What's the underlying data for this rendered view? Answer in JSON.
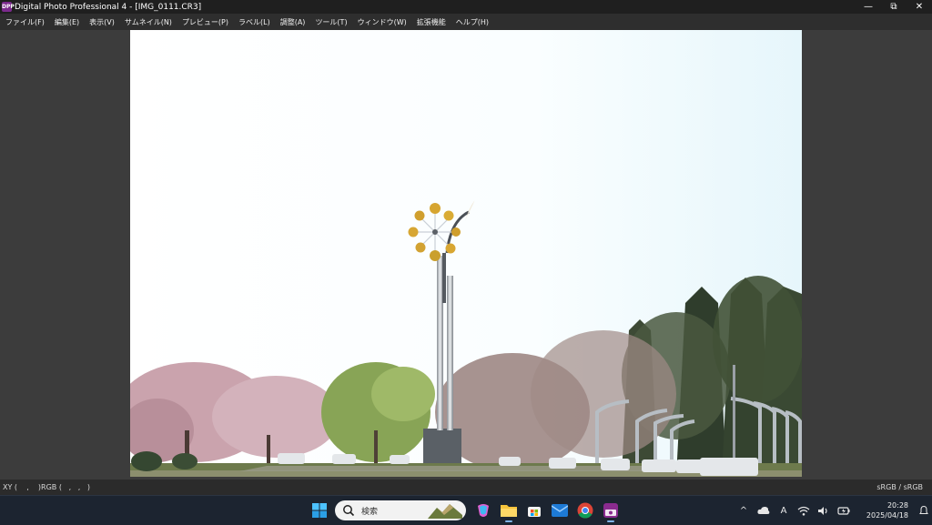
{
  "window": {
    "title": "Digital Photo Professional 4 - [IMG_0111.CR3]",
    "icon_text": "DPP",
    "minimize": "—",
    "restore": "⧉",
    "close": "✕"
  },
  "menu": [
    "ファイル(F)",
    "編集(E)",
    "表示(V)",
    "サムネイル(N)",
    "プレビュー(P)",
    "ラベル(L)",
    "調整(A)",
    "ツール(T)",
    "ウィンドウ(W)",
    "拡張機能",
    "ヘルプ(H)"
  ],
  "status": {
    "left": "XY (    ,    )RGB (   ,   ,   )",
    "right": "sRGB / sRGB"
  },
  "taskbar": {
    "search_placeholder": "検索",
    "apps": [
      "start-icon",
      "search-box",
      "copilot-icon",
      "file-explorer-icon",
      "store-icon",
      "mail-icon",
      "chrome-icon",
      "dpp-icon"
    ],
    "tray": {
      "chevron": "^",
      "ime": "A",
      "time": "20:28",
      "date": "2025/04/18"
    }
  },
  "colors": {
    "sky": "#f4fbfd",
    "accent": "#7fb3e8"
  }
}
